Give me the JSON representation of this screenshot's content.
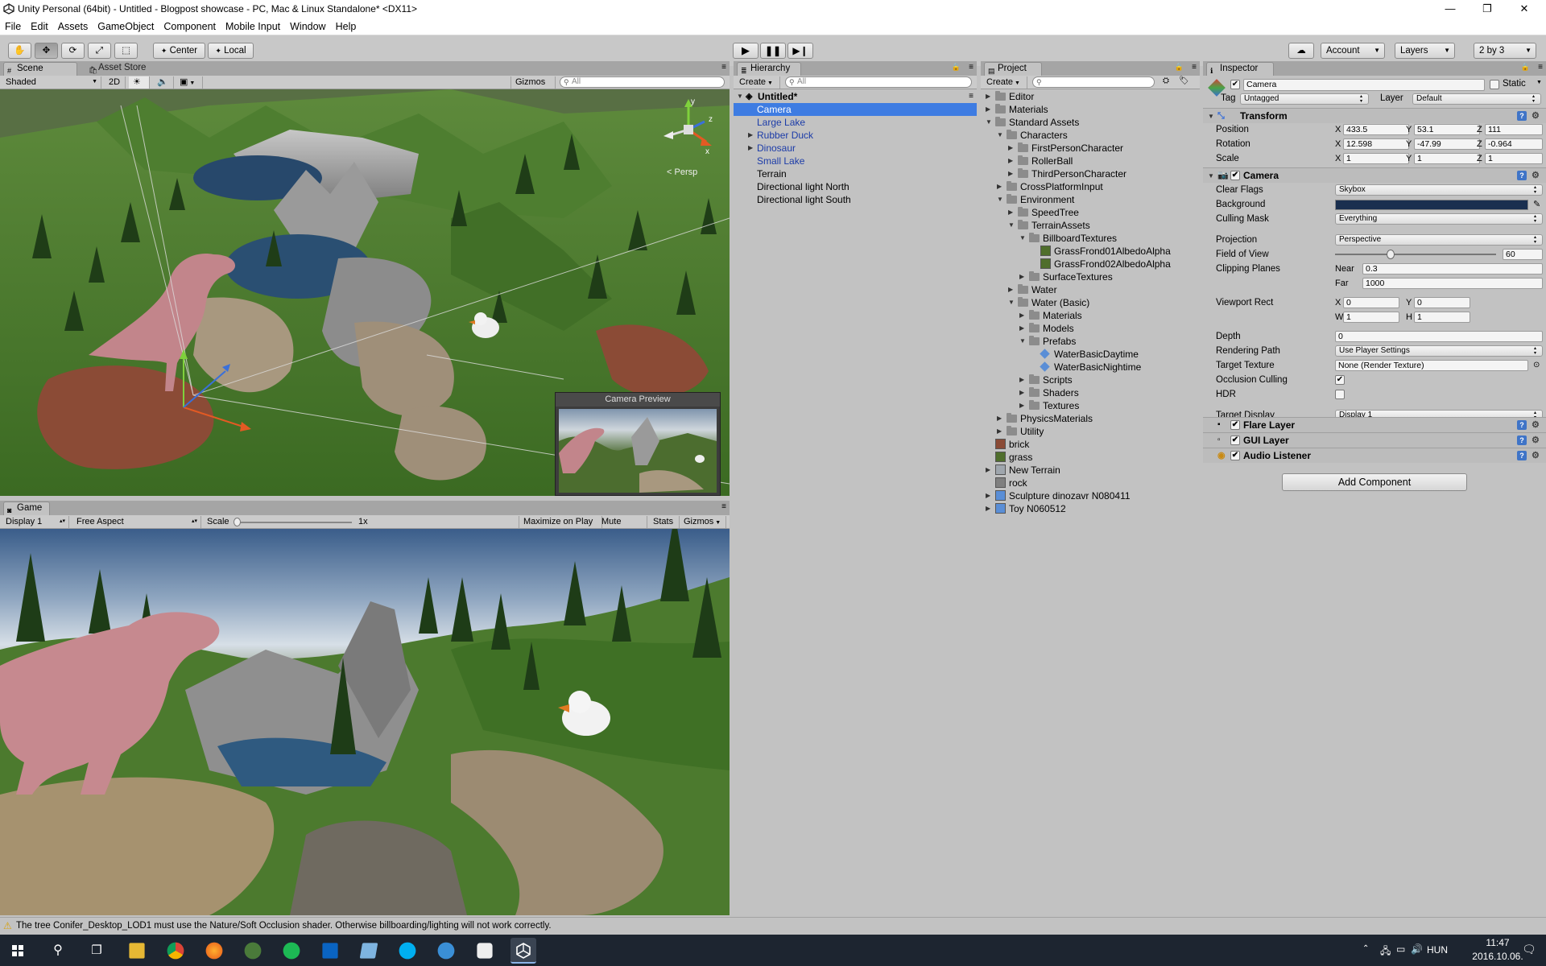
{
  "window": {
    "title": "Unity Personal (64bit) - Untitled - Blogpost showcase - PC, Mac & Linux Standalone* <DX11>",
    "minimize": "—",
    "maximize": "❐",
    "close": "✕"
  },
  "menu": [
    "File",
    "Edit",
    "Assets",
    "GameObject",
    "Component",
    "Mobile Input",
    "Window",
    "Help"
  ],
  "toolbar": {
    "pivot": "Center",
    "space": "Local",
    "account": "Account",
    "layers": "Layers",
    "layout": "2 by 3"
  },
  "scene": {
    "tab": "Scene",
    "tab2": "Asset Store",
    "shading": "Shaded",
    "mode2d": "2D",
    "gizmos": "Gizmos",
    "search_placeholder": "All",
    "persp": "Persp",
    "camera_preview": "Camera Preview",
    "gizmo_axes": {
      "x": "x",
      "y": "y",
      "z": "z"
    }
  },
  "game": {
    "tab": "Game",
    "display": "Display 1",
    "aspect": "Free Aspect",
    "scale_label": "Scale",
    "scale_value": "1x",
    "maximize": "Maximize on Play",
    "mute": "Mute audio",
    "stats": "Stats",
    "gizmos": "Gizmos"
  },
  "hierarchy": {
    "tab": "Hierarchy",
    "create": "Create",
    "search_placeholder": "All",
    "scene": "Untitled*",
    "items": [
      {
        "label": "Camera",
        "selected": true,
        "prefab": true
      },
      {
        "label": "Large Lake",
        "prefab": true
      },
      {
        "label": "Rubber Duck",
        "prefab": true,
        "expandable": true
      },
      {
        "label": "Dinosaur",
        "prefab": true,
        "expandable": true
      },
      {
        "label": "Small Lake",
        "prefab": true
      },
      {
        "label": "Terrain"
      },
      {
        "label": "Directional light North"
      },
      {
        "label": "Directional light South"
      }
    ]
  },
  "project": {
    "tab": "Project",
    "create": "Create",
    "items": [
      {
        "label": "Editor",
        "depth": 0,
        "arrow": "closed",
        "icon": "folder"
      },
      {
        "label": "Materials",
        "depth": 0,
        "arrow": "closed",
        "icon": "folder"
      },
      {
        "label": "Standard Assets",
        "depth": 0,
        "arrow": "open",
        "icon": "folder"
      },
      {
        "label": "Characters",
        "depth": 1,
        "arrow": "open",
        "icon": "folder"
      },
      {
        "label": "FirstPersonCharacter",
        "depth": 2,
        "arrow": "closed",
        "icon": "folder"
      },
      {
        "label": "RollerBall",
        "depth": 2,
        "arrow": "closed",
        "icon": "folder"
      },
      {
        "label": "ThirdPersonCharacter",
        "depth": 2,
        "arrow": "closed",
        "icon": "folder"
      },
      {
        "label": "CrossPlatformInput",
        "depth": 1,
        "arrow": "closed",
        "icon": "folder"
      },
      {
        "label": "Environment",
        "depth": 1,
        "arrow": "open",
        "icon": "folder"
      },
      {
        "label": "SpeedTree",
        "depth": 2,
        "arrow": "closed",
        "icon": "folder"
      },
      {
        "label": "TerrainAssets",
        "depth": 2,
        "arrow": "open",
        "icon": "folder"
      },
      {
        "label": "BillboardTextures",
        "depth": 3,
        "arrow": "open",
        "icon": "folder"
      },
      {
        "label": "GrassFrond01AlbedoAlpha",
        "depth": 4,
        "arrow": "none",
        "icon": "texture-green"
      },
      {
        "label": "GrassFrond02AlbedoAlpha",
        "depth": 4,
        "arrow": "none",
        "icon": "texture-green"
      },
      {
        "label": "SurfaceTextures",
        "depth": 3,
        "arrow": "closed",
        "icon": "folder"
      },
      {
        "label": "Water",
        "depth": 2,
        "arrow": "closed",
        "icon": "folder"
      },
      {
        "label": "Water (Basic)",
        "depth": 2,
        "arrow": "open",
        "icon": "folder"
      },
      {
        "label": "Materials",
        "depth": 3,
        "arrow": "closed",
        "icon": "folder"
      },
      {
        "label": "Models",
        "depth": 3,
        "arrow": "closed",
        "icon": "folder"
      },
      {
        "label": "Prefabs",
        "depth": 3,
        "arrow": "open",
        "icon": "folder"
      },
      {
        "label": "WaterBasicDaytime",
        "depth": 4,
        "arrow": "none",
        "icon": "prefab"
      },
      {
        "label": "WaterBasicNightime",
        "depth": 4,
        "arrow": "none",
        "icon": "prefab"
      },
      {
        "label": "Scripts",
        "depth": 3,
        "arrow": "closed",
        "icon": "folder"
      },
      {
        "label": "Shaders",
        "depth": 3,
        "arrow": "closed",
        "icon": "folder"
      },
      {
        "label": "Textures",
        "depth": 3,
        "arrow": "closed",
        "icon": "folder"
      },
      {
        "label": "PhysicsMaterials",
        "depth": 1,
        "arrow": "closed",
        "icon": "folder"
      },
      {
        "label": "Utility",
        "depth": 1,
        "arrow": "closed",
        "icon": "folder"
      },
      {
        "label": "brick",
        "depth": 0,
        "arrow": "none",
        "icon": "texture-brick"
      },
      {
        "label": "grass",
        "depth": 0,
        "arrow": "none",
        "icon": "texture-green"
      },
      {
        "label": "New Terrain",
        "depth": 0,
        "arrow": "closed",
        "icon": "terrain"
      },
      {
        "label": "rock",
        "depth": 0,
        "arrow": "none",
        "icon": "texture-rock"
      },
      {
        "label": "Sculpture dinozavr N080411",
        "depth": 0,
        "arrow": "closed",
        "icon": "model"
      },
      {
        "label": "Toy N060512",
        "depth": 0,
        "arrow": "closed",
        "icon": "model"
      }
    ]
  },
  "inspector": {
    "tab": "Inspector",
    "object_name": "Camera",
    "static_label": "Static",
    "tag_label": "Tag",
    "tag_value": "Untagged",
    "layer_label": "Layer",
    "layer_value": "Default",
    "transform": {
      "title": "Transform",
      "position_label": "Position",
      "rotation_label": "Rotation",
      "scale_label": "Scale",
      "position": {
        "x": "433.5",
        "y": "53.1",
        "z": "111"
      },
      "rotation": {
        "x": "12.598",
        "y": "-47.99",
        "z": "-0.964"
      },
      "scale": {
        "x": "1",
        "y": "1",
        "z": "1"
      }
    },
    "camera": {
      "title": "Camera",
      "clear_flags_label": "Clear Flags",
      "clear_flags": "Skybox",
      "background_label": "Background",
      "background_color": "#1a2f4f",
      "culling_label": "Culling Mask",
      "culling": "Everything",
      "projection_label": "Projection",
      "projection": "Perspective",
      "fov_label": "Field of View",
      "fov": "60",
      "fov_slider": 0.33,
      "clipping_label": "Clipping Planes",
      "near_label": "Near",
      "near": "0.3",
      "far_label": "Far",
      "far": "1000",
      "viewport_label": "Viewport Rect",
      "vx": "0",
      "vy": "0",
      "vw": "1",
      "vh": "1",
      "depth_label": "Depth",
      "depth": "0",
      "rendering_label": "Rendering Path",
      "rendering": "Use Player Settings",
      "target_texture_label": "Target Texture",
      "target_texture": "None (Render Texture)",
      "occlusion_label": "Occlusion Culling",
      "hdr_label": "HDR",
      "target_display_label": "Target Display",
      "target_display": "Display 1"
    },
    "flare_layer": "Flare Layer",
    "gui_layer": "GUI Layer",
    "audio_listener": "Audio Listener",
    "add_component": "Add Component"
  },
  "status": {
    "message": "The tree Conifer_Desktop_LOD1 must use the Nature/Soft Occlusion shader. Otherwise billboarding/lighting will not work correctly."
  },
  "taskbar": {
    "language": "HUN",
    "time": "11:47",
    "date": "2016.10.06."
  },
  "colors": {
    "selection": "#3e7ce2",
    "panel": "#c2c2c2",
    "taskbar": "#1d2530",
    "prefab_text": "#1c3ca8"
  }
}
